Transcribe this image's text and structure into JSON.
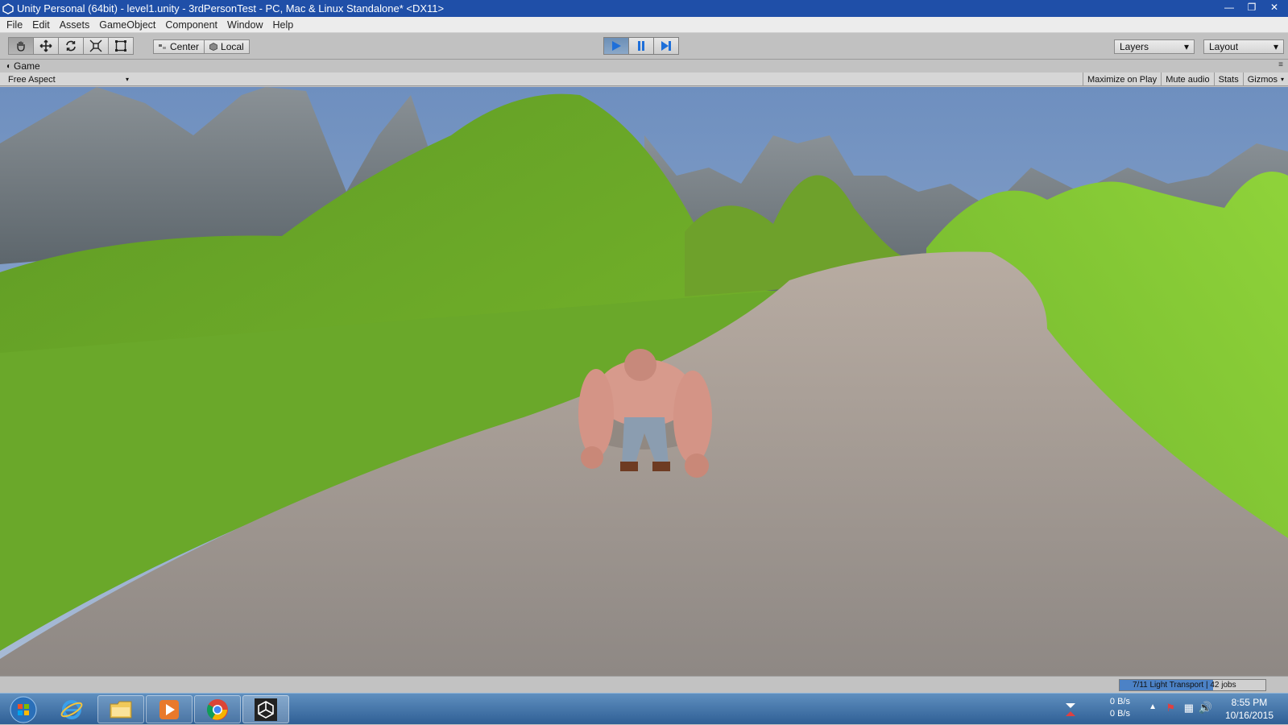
{
  "window": {
    "title": "Unity Personal (64bit) - level1.unity - 3rdPersonTest - PC, Mac & Linux Standalone* <DX11>"
  },
  "menu": [
    "File",
    "Edit",
    "Assets",
    "GameObject",
    "Component",
    "Window",
    "Help"
  ],
  "toolbar": {
    "tools": [
      "hand-tool",
      "move-tool",
      "rotate-tool",
      "scale-tool",
      "rect-tool"
    ],
    "pivot_label": "Center",
    "space_label": "Local",
    "layers_label": "Layers",
    "layout_label": "Layout"
  },
  "game_view": {
    "tab_label": "Game",
    "aspect_label": "Free Aspect",
    "options": [
      "Maximize on Play",
      "Mute audio",
      "Stats",
      "Gizmos"
    ]
  },
  "status": {
    "progress_text": "7/11 Light Transport | 42 jobs",
    "progress": 0.64
  },
  "tray": {
    "net_up": "0 B/s",
    "net_down": "0 B/s",
    "time": "8:55 PM",
    "date": "10/16/2015"
  }
}
